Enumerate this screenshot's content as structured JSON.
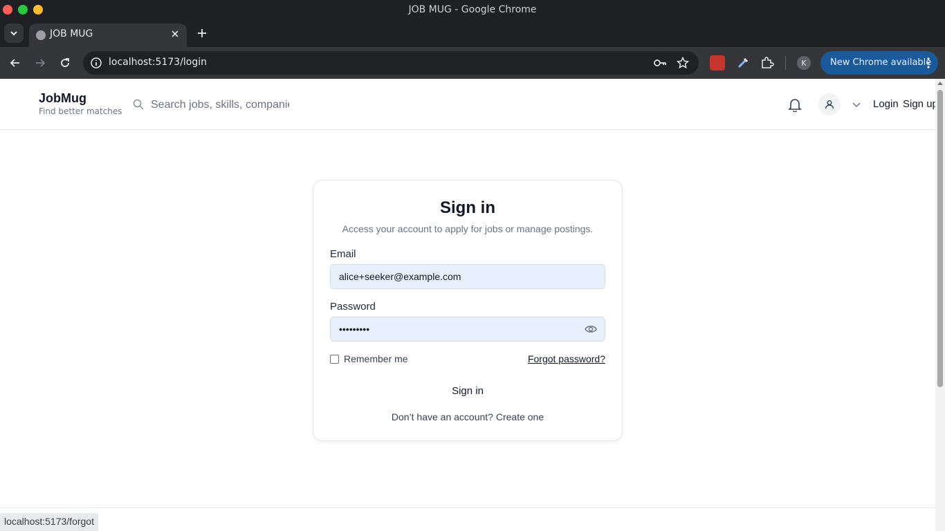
{
  "window": {
    "title": "JOB MUG - Google Chrome"
  },
  "tabs": [
    {
      "label": "JOB MUG"
    }
  ],
  "toolbar": {
    "url": "localhost:5173/login",
    "update_label": "New Chrome available",
    "profile_initial": "K"
  },
  "header": {
    "brand": "JobMug",
    "tagline": "Find better matches",
    "search_placeholder": "Search jobs, skills, companies",
    "login": "Login",
    "signup": "Sign up"
  },
  "card": {
    "title": "Sign in",
    "subtitle": "Access your account to apply for jobs or manage postings.",
    "email_label": "Email",
    "email_value": "alice+seeker@example.com",
    "password_label": "Password",
    "password_value": "•••••••••",
    "remember_label": "Remember me",
    "forgot_label": "Forgot password?",
    "signin_button": "Sign in",
    "create_account": "Don’t have an account? Create one"
  },
  "status_bar": {
    "hover_url": "localhost:5173/forgot"
  },
  "colors": {
    "chrome_dark": "#1f2023",
    "update_button": "#1a5a9a",
    "field_fill": "#e8f0fe"
  }
}
